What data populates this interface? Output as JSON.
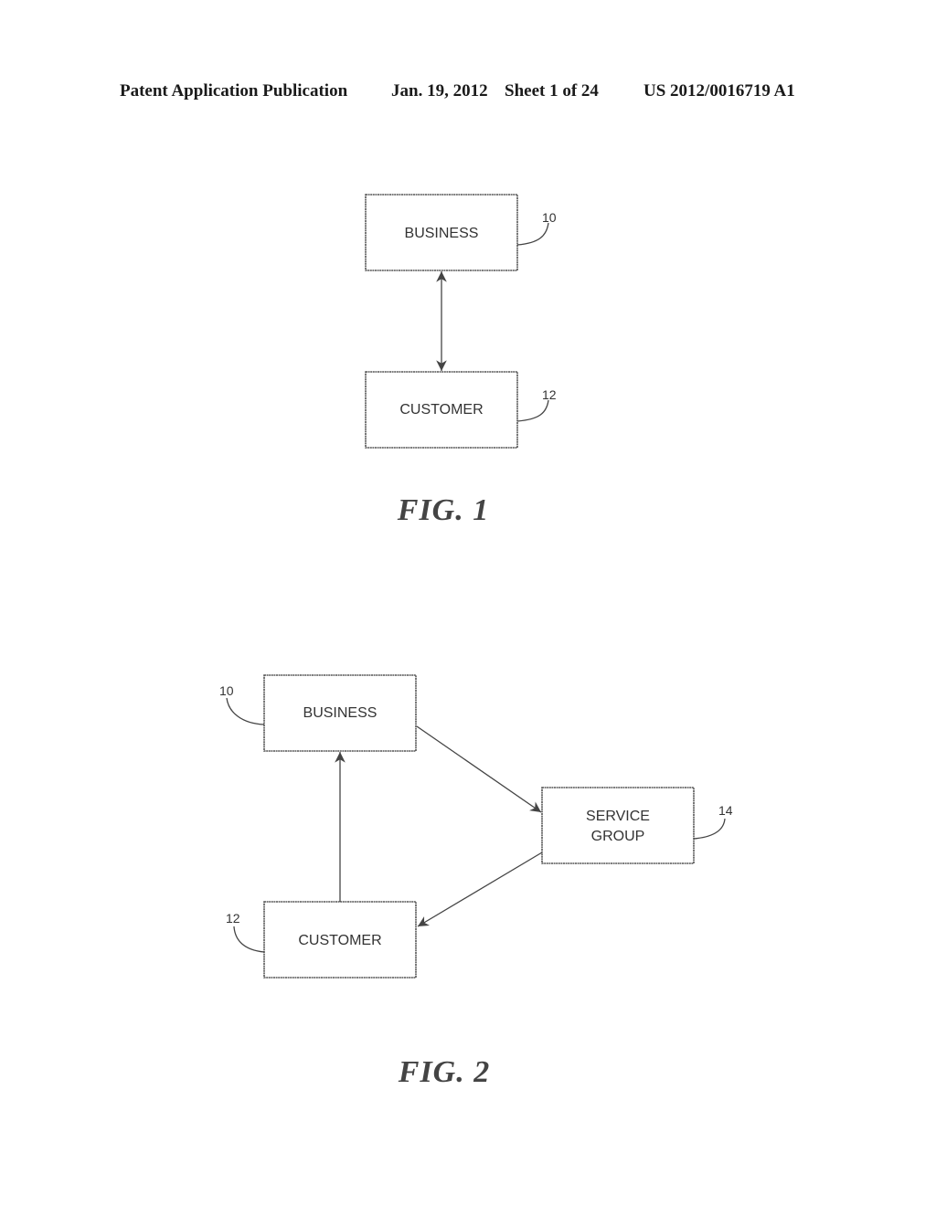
{
  "header": {
    "publication": "Patent Application Publication",
    "date": "Jan. 19, 2012",
    "sheet": "Sheet 1 of 24",
    "number": "US 2012/0016719 A1"
  },
  "fig1": {
    "caption": "FIG. 1",
    "nodes": [
      {
        "id": "business",
        "label": "BUSINESS",
        "ref": "10"
      },
      {
        "id": "customer",
        "label": "CUSTOMER",
        "ref": "12"
      }
    ],
    "edges": [
      {
        "from": "business",
        "to": "customer",
        "direction": "bidirectional"
      }
    ]
  },
  "fig2": {
    "caption": "FIG. 2",
    "nodes": [
      {
        "id": "business",
        "label": "BUSINESS",
        "ref": "10"
      },
      {
        "id": "service_group",
        "label_line1": "SERVICE",
        "label_line2": "GROUP",
        "ref": "14"
      },
      {
        "id": "customer",
        "label": "CUSTOMER",
        "ref": "12"
      }
    ],
    "edges": [
      {
        "from": "business",
        "to": "service_group"
      },
      {
        "from": "service_group",
        "to": "customer"
      },
      {
        "from": "customer",
        "to": "business"
      }
    ]
  }
}
